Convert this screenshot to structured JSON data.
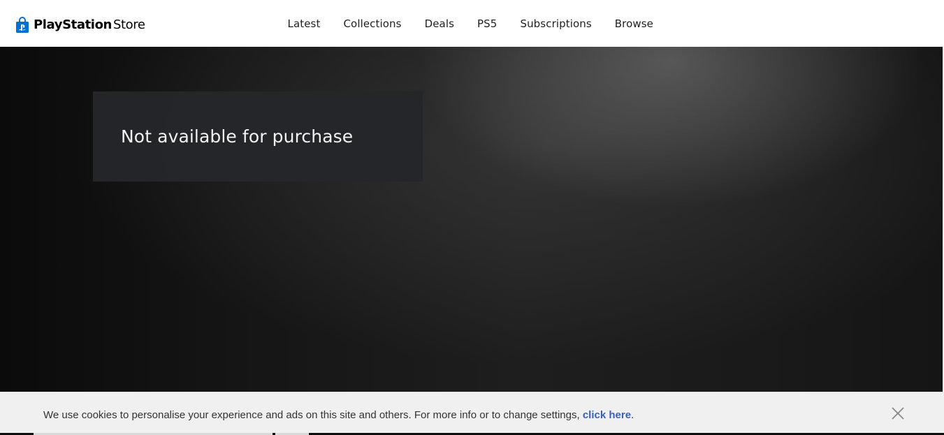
{
  "header": {
    "logo": {
      "icon": "playstation-bag-icon",
      "brand": "PlayStation",
      "suffix": "Store",
      "color": "#0070d1"
    },
    "nav": [
      {
        "label": "Latest"
      },
      {
        "label": "Collections"
      },
      {
        "label": "Deals"
      },
      {
        "label": "PS5"
      },
      {
        "label": "Subscriptions"
      },
      {
        "label": "Browse"
      }
    ]
  },
  "hero": {
    "purchase_status": "Not available for purchase"
  },
  "cookie_banner": {
    "message": "We use cookies to personalise your experience and ads on this site and others. For more info or to change settings, ",
    "link_label": "click here",
    "trailing": ".",
    "close_icon": "close-icon",
    "link_color": "#3a5fb8"
  }
}
